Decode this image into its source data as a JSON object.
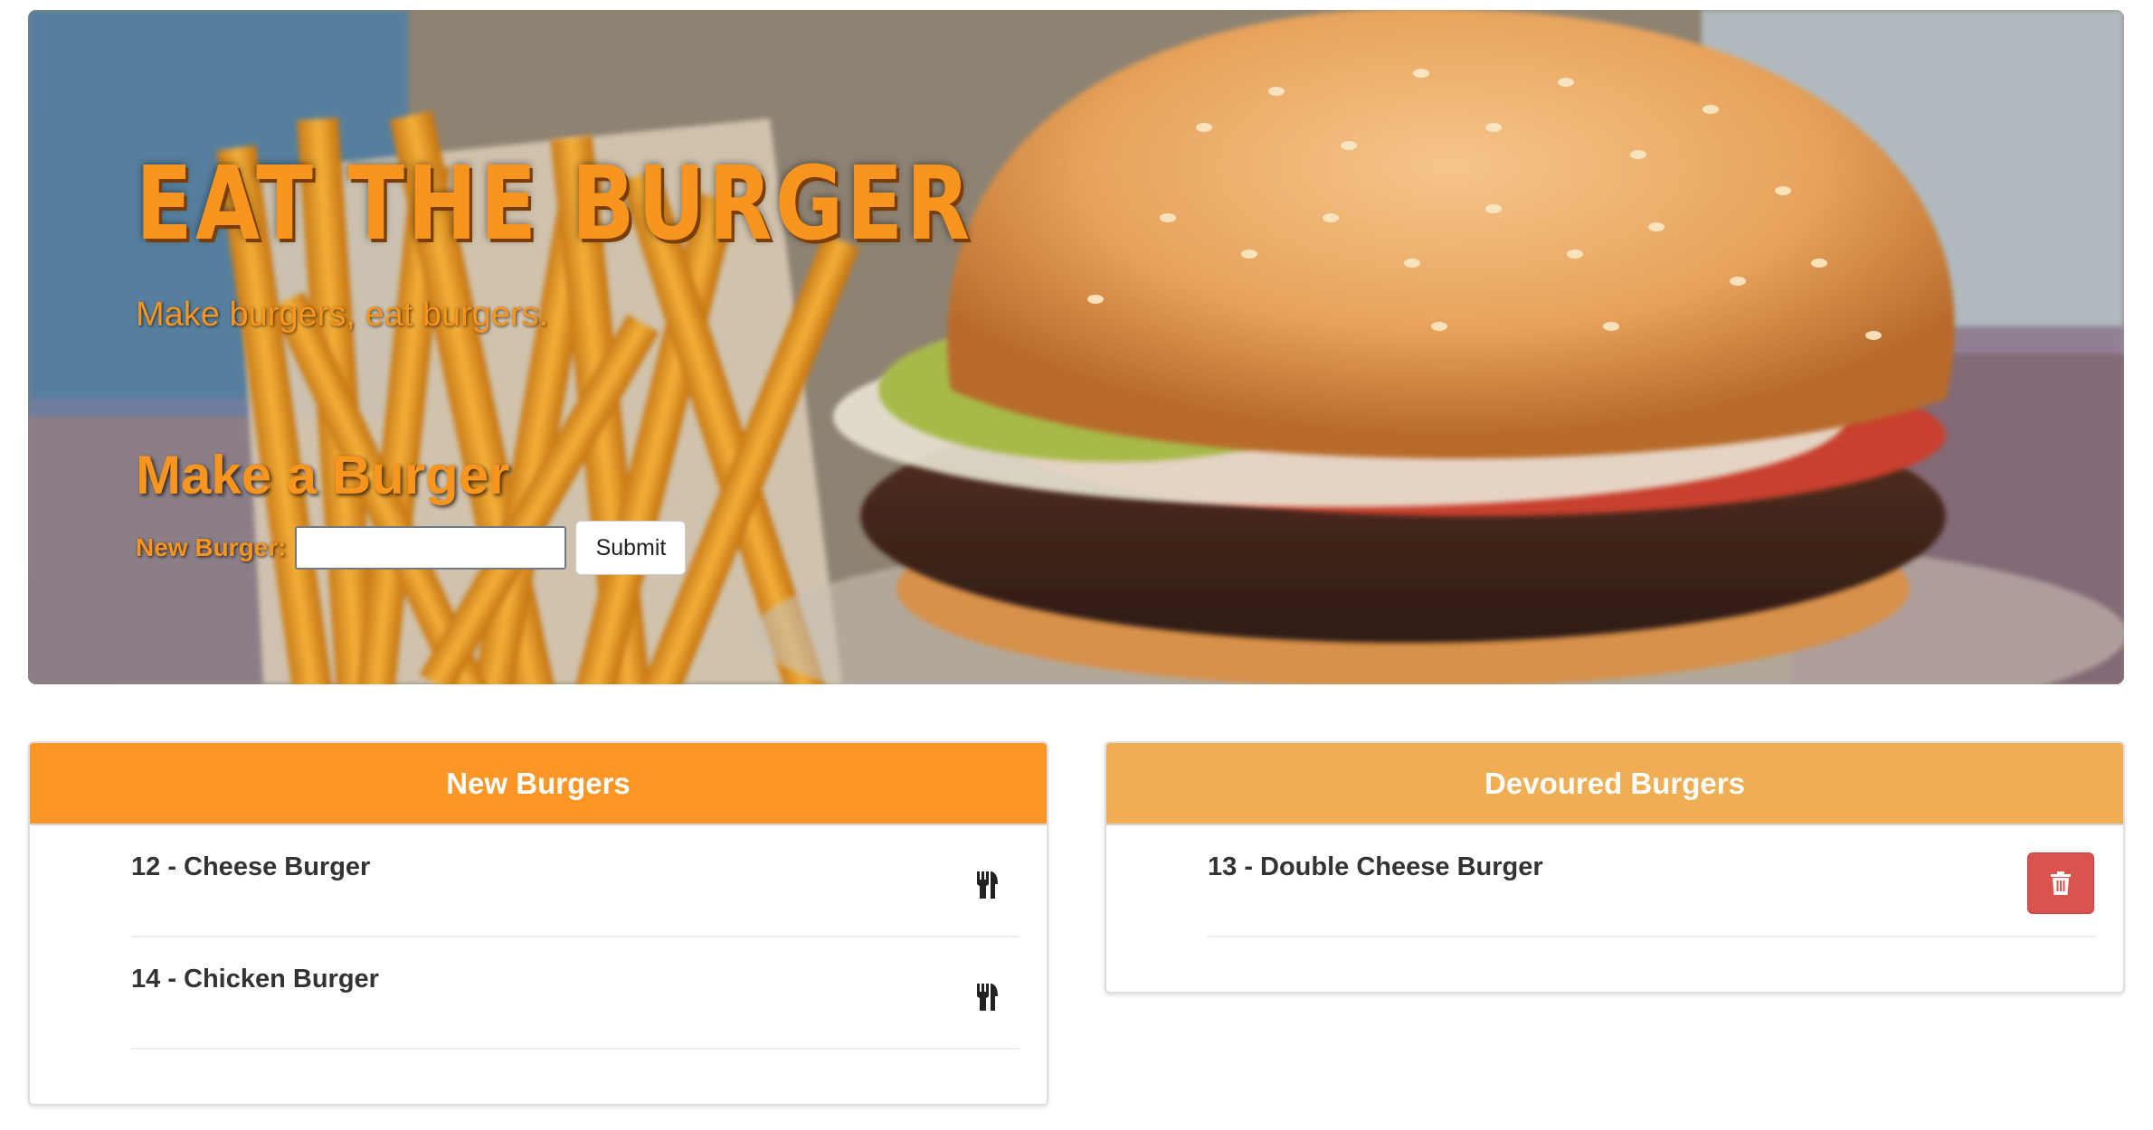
{
  "hero": {
    "title": "Eat the Burger",
    "tagline": "Make burgers, eat burgers.",
    "form_title": "Make a Burger",
    "input_label": "New Burger:",
    "input_value": "",
    "input_placeholder": "",
    "submit_label": "Submit"
  },
  "new_burgers": {
    "header": "New Burgers",
    "items": [
      {
        "label": "12 - Cheese Burger",
        "action_icon": "utensils-icon"
      },
      {
        "label": "14 - Chicken Burger",
        "action_icon": "utensils-icon"
      }
    ]
  },
  "devoured_burgers": {
    "header": "Devoured Burgers",
    "items": [
      {
        "label": "13 - Double Cheese Burger",
        "action_icon": "trash-icon"
      }
    ]
  },
  "colors": {
    "accent_orange": "#f7951f",
    "new_header": "#fb9627",
    "devoured_header": "#efad54",
    "delete_button": "#d9534f"
  }
}
